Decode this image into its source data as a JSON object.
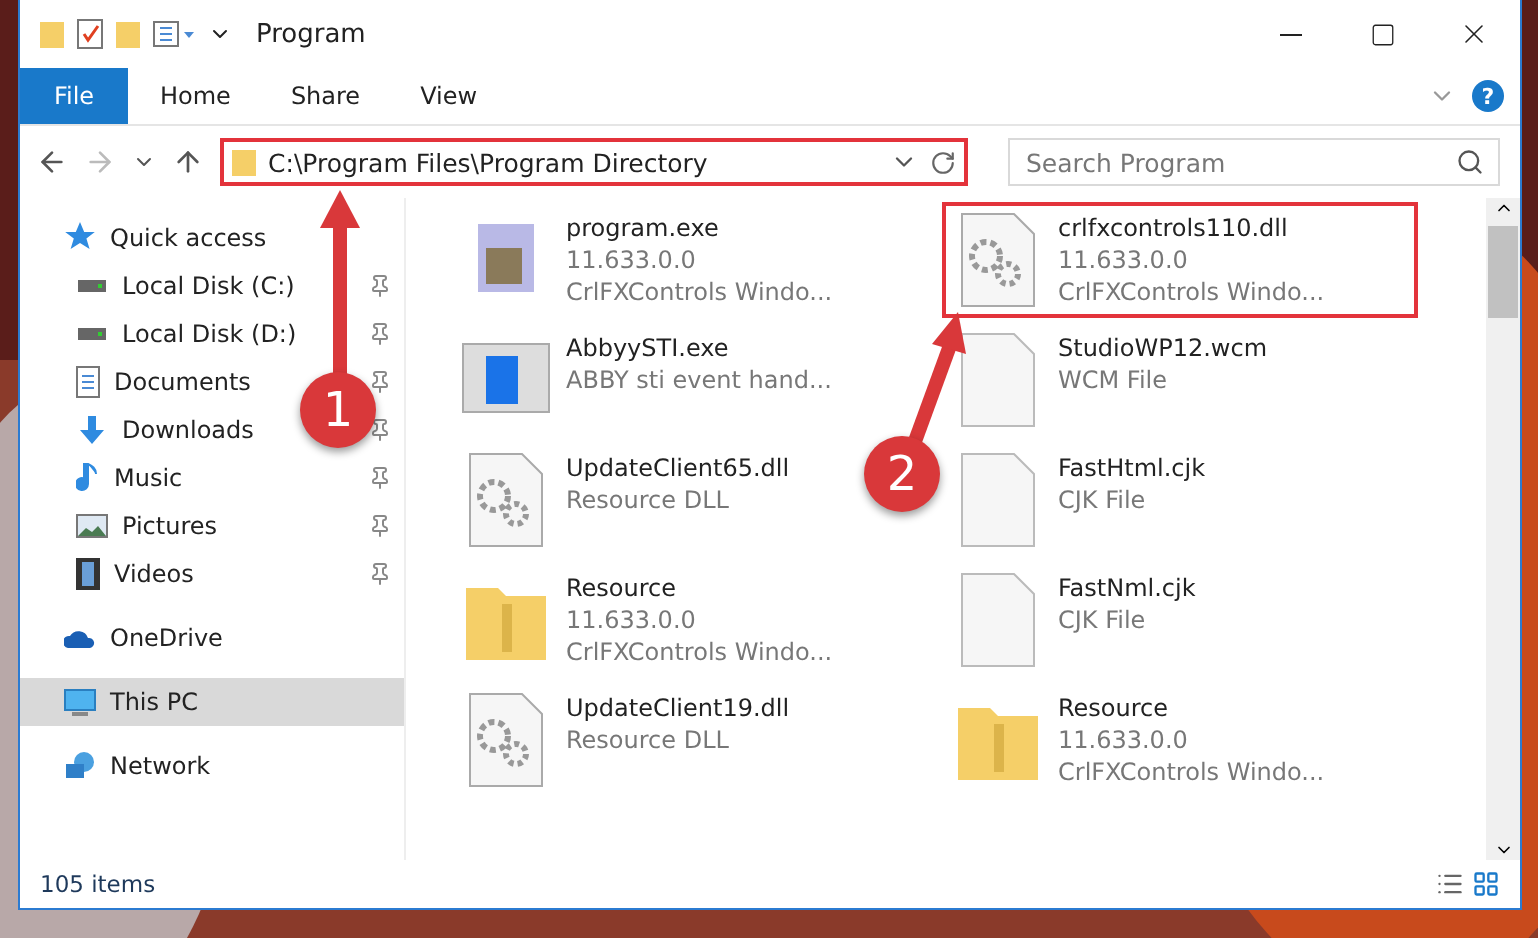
{
  "window": {
    "title": "Program"
  },
  "ribbon": {
    "tabs": [
      {
        "label": "File",
        "selected": true
      },
      {
        "label": "Home",
        "selected": false
      },
      {
        "label": "Share",
        "selected": false
      },
      {
        "label": "View",
        "selected": false
      }
    ],
    "help": "?"
  },
  "address_bar": {
    "path": "C:\\Program Files\\Program Directory",
    "highlighted": true
  },
  "search": {
    "placeholder": "Search Program"
  },
  "sidebar": {
    "items": [
      {
        "label": "Quick access",
        "selected": false,
        "pinned": false,
        "children": [
          {
            "label": "Local Disk (C:)",
            "selected": false,
            "pinned": true
          },
          {
            "label": "Local Disk (D:)",
            "selected": false,
            "pinned": true
          },
          {
            "label": "Documents",
            "selected": false,
            "pinned": true
          },
          {
            "label": "Downloads",
            "selected": false,
            "pinned": true
          },
          {
            "label": "Music",
            "selected": false,
            "pinned": true
          },
          {
            "label": "Pictures",
            "selected": false,
            "pinned": true
          },
          {
            "label": "Videos",
            "selected": false,
            "pinned": true
          }
        ]
      },
      {
        "label": "OneDrive",
        "selected": false,
        "pinned": false
      },
      {
        "label": "This PC",
        "selected": true,
        "pinned": false
      },
      {
        "label": "Network",
        "selected": false,
        "pinned": false
      }
    ]
  },
  "files": [
    {
      "name": "program.exe",
      "lines": [
        "11.633.0.0",
        "CrlFXControls Windo..."
      ],
      "kind": "app",
      "highlighted": false
    },
    {
      "name": "crlfxcontrols110.dll",
      "lines": [
        "11.633.0.0",
        "CrlFXControls Windo..."
      ],
      "kind": "dll",
      "highlighted": true
    },
    {
      "name": "AbbyySTI.exe",
      "lines": [
        "ABBY sti event hand..."
      ],
      "kind": "window",
      "highlighted": false
    },
    {
      "name": "StudioWP12.wcm",
      "lines": [
        "WCM File"
      ],
      "kind": "file",
      "highlighted": false
    },
    {
      "name": "UpdateClient65.dll",
      "lines": [
        "Resource DLL"
      ],
      "kind": "dll",
      "highlighted": false
    },
    {
      "name": "FastHtml.cjk",
      "lines": [
        "CJK File"
      ],
      "kind": "file",
      "highlighted": false
    },
    {
      "name": "Resource",
      "lines": [
        "11.633.0.0",
        "CrlFXControls Windo..."
      ],
      "kind": "folder",
      "highlighted": false
    },
    {
      "name": "FastNml.cjk",
      "lines": [
        "CJK File"
      ],
      "kind": "file",
      "highlighted": false
    },
    {
      "name": "UpdateClient19.dll",
      "lines": [
        "Resource DLL"
      ],
      "kind": "dll",
      "highlighted": false
    },
    {
      "name": "Resource",
      "lines": [
        "11.633.0.0",
        "CrlFXControls Windo..."
      ],
      "kind": "folder",
      "highlighted": false
    }
  ],
  "status_bar": {
    "count": "105 items"
  },
  "callouts": [
    {
      "number": "1"
    },
    {
      "number": "2"
    }
  ]
}
